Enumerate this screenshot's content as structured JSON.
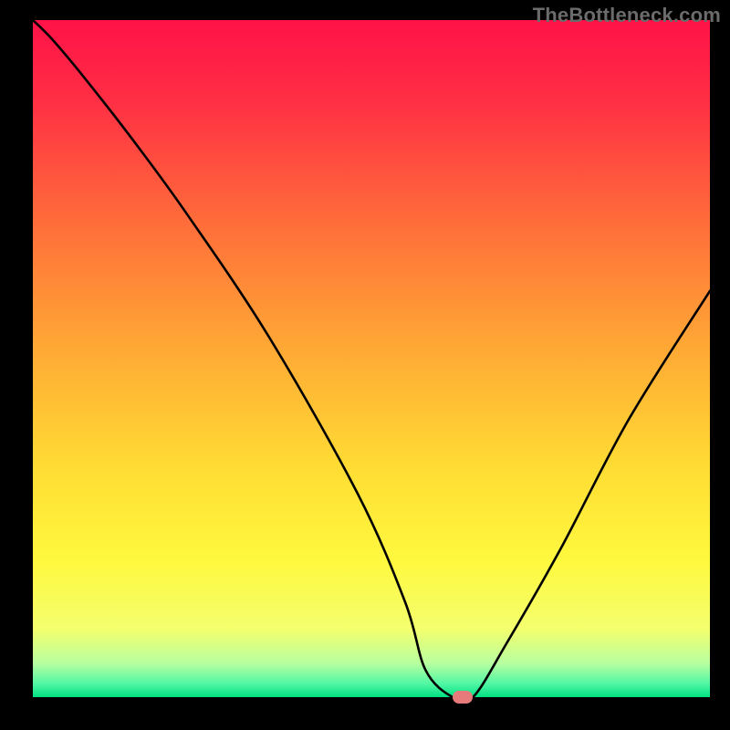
{
  "watermark": "TheBottleneck.com",
  "chart_data": {
    "type": "line",
    "title": "",
    "xlabel": "",
    "ylabel": "",
    "xlim": [
      0,
      100
    ],
    "ylim": [
      0,
      100
    ],
    "grid": false,
    "background": "vertical-gradient red→orange→yellow→green",
    "gradient_stops": [
      {
        "offset": 0.0,
        "color": "#ff1248"
      },
      {
        "offset": 0.12,
        "color": "#ff2f44"
      },
      {
        "offset": 0.3,
        "color": "#ff6d3a"
      },
      {
        "offset": 0.48,
        "color": "#ffa735"
      },
      {
        "offset": 0.66,
        "color": "#ffdc33"
      },
      {
        "offset": 0.8,
        "color": "#fff93f"
      },
      {
        "offset": 0.9,
        "color": "#f3ff6e"
      },
      {
        "offset": 0.95,
        "color": "#b8ffa0"
      },
      {
        "offset": 0.98,
        "color": "#52f7a4"
      },
      {
        "offset": 1.0,
        "color": "#00e183"
      }
    ],
    "series": [
      {
        "name": "bottleneck-curve",
        "x": [
          0,
          3,
          8,
          15,
          23,
          35,
          48,
          55,
          58,
          62,
          65,
          70,
          78,
          88,
          100
        ],
        "values": [
          100,
          97,
          91,
          82,
          71,
          53,
          30,
          14,
          4,
          0,
          0,
          8,
          22,
          41,
          60
        ]
      }
    ],
    "marker": {
      "x": 63.5,
      "y": 0,
      "color": "#e77b7b"
    }
  }
}
